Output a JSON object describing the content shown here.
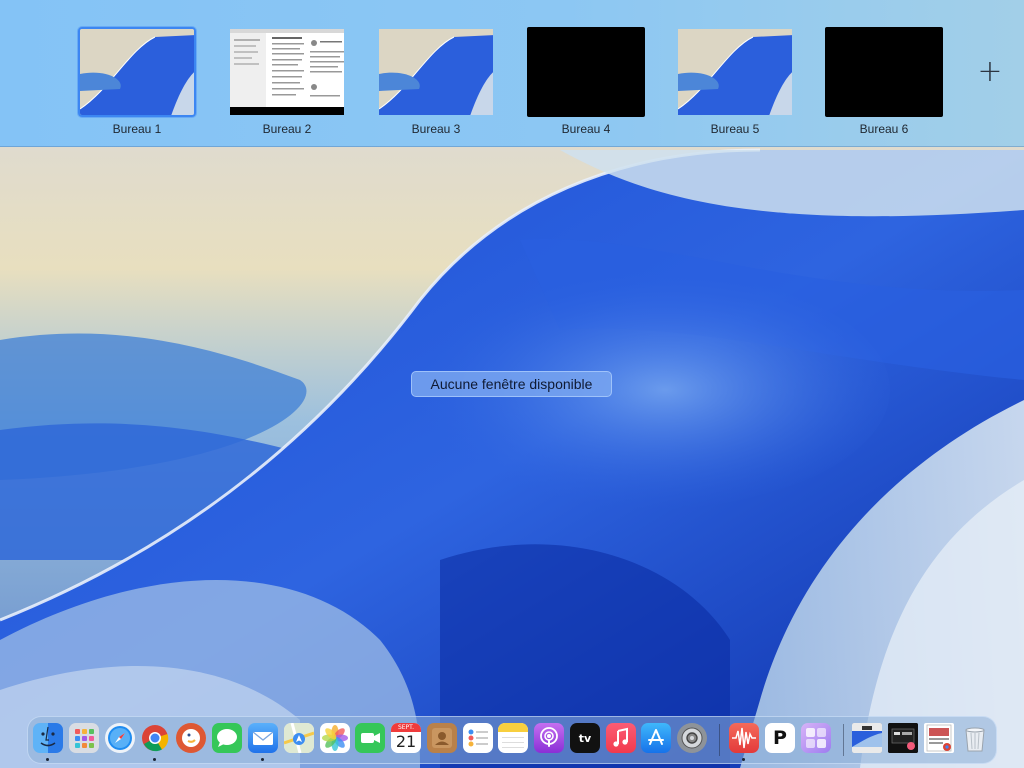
{
  "spaces": [
    {
      "label": "Bureau 1",
      "thumbnail": "wallpaper",
      "active": true
    },
    {
      "label": "Bureau 2",
      "thumbnail": "document"
    },
    {
      "label": "Bureau 3",
      "thumbnail": "wallpaper"
    },
    {
      "label": "Bureau 4",
      "thumbnail": "black"
    },
    {
      "label": "Bureau 5",
      "thumbnail": "wallpaper"
    },
    {
      "label": "Bureau 6",
      "thumbnail": "black"
    }
  ],
  "add_space_icon": "plus-icon",
  "add_space_glyph": "+",
  "message": "Aucune fenêtre disponible",
  "calendar": {
    "month": "SEPT.",
    "day": "21"
  },
  "tv_label": "tv",
  "pages_letter": "P",
  "dock": [
    {
      "name": "finder-icon",
      "running": true
    },
    {
      "name": "launchpad-icon"
    },
    {
      "name": "safari-icon",
      "running": true
    },
    {
      "name": "chrome-icon",
      "running": true
    },
    {
      "name": "duckduckgo-icon"
    },
    {
      "name": "messages-icon"
    },
    {
      "name": "mail-icon",
      "running": true
    },
    {
      "name": "maps-icon"
    },
    {
      "name": "photos-icon"
    },
    {
      "name": "facetime-icon"
    },
    {
      "name": "calendar-icon"
    },
    {
      "name": "contacts-icon"
    },
    {
      "name": "reminders-icon"
    },
    {
      "name": "notes-icon"
    },
    {
      "name": "podcasts-icon"
    },
    {
      "name": "apple-tv-icon"
    },
    {
      "name": "music-icon"
    },
    {
      "name": "app-store-icon"
    },
    {
      "name": "system-settings-icon"
    },
    {
      "name": "voice-app-icon",
      "running": true
    },
    {
      "name": "p-app-icon"
    },
    {
      "name": "grid-app-icon"
    },
    {
      "name": "recent-window-1-icon"
    },
    {
      "name": "recent-window-2-icon"
    },
    {
      "name": "recent-document-icon"
    },
    {
      "name": "trash-icon"
    }
  ],
  "colors": {
    "accent": "#3c86f2",
    "spaces_bar": "#8cc7f3"
  }
}
